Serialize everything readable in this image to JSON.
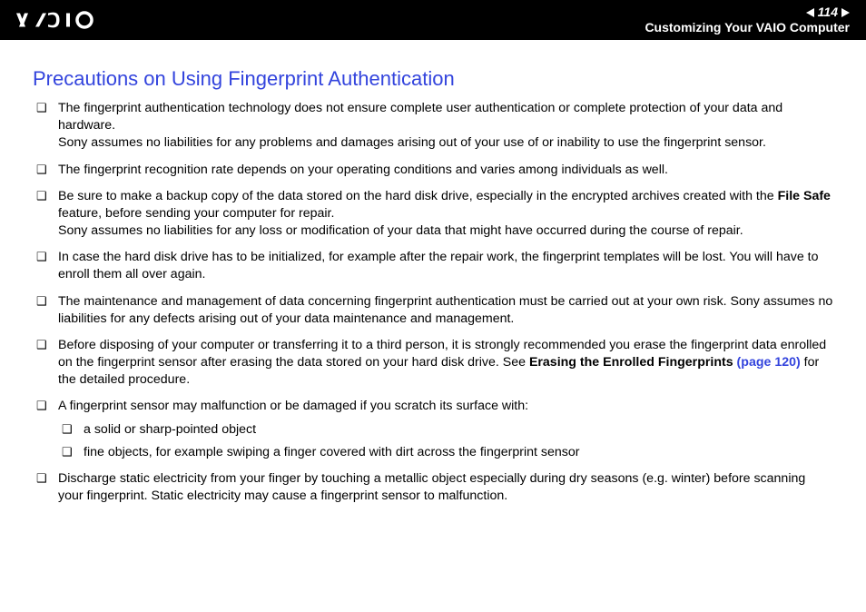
{
  "header": {
    "page_number": "114",
    "section": "Customizing Your VAIO Computer"
  },
  "title": "Precautions on Using Fingerprint Authentication",
  "bullets": [
    {
      "text_a": "The fingerprint authentication technology does not ensure complete user authentication or complete protection of your data and hardware.",
      "text_b": "Sony assumes no liabilities for any problems and damages arising out of your use of or inability to use the fingerprint sensor."
    },
    {
      "text_a": "The fingerprint recognition rate depends on your operating conditions and varies among individuals as well."
    },
    {
      "pre": "Be sure to make a backup copy of the data stored on the hard disk drive, especially in the encrypted archives created with the ",
      "bold": "File Safe",
      "post": " feature, before sending your computer for repair.",
      "text_b": "Sony assumes no liabilities for any loss or modification of your data that might have occurred during the course of repair."
    },
    {
      "text_a": "In case the hard disk drive has to be initialized, for example after the repair work, the fingerprint templates will be lost. You will have to enroll them all over again."
    },
    {
      "text_a": "The maintenance and management of data concerning fingerprint authentication must be carried out at your own risk. Sony assumes no liabilities for any defects arising out of your data maintenance and management."
    },
    {
      "pre": "Before disposing of your computer or transferring it to a third person, it is strongly recommended you erase the fingerprint data enrolled on the fingerprint sensor after erasing the data stored on your hard disk drive. See ",
      "bold": "Erasing the Enrolled Fingerprints ",
      "link": "(page 120)",
      "post": " for the detailed procedure."
    },
    {
      "text_a": "A fingerprint sensor may malfunction or be damaged if you scratch its surface with:",
      "sub": [
        "a solid or sharp-pointed object",
        "fine objects, for example swiping a finger covered with dirt across the fingerprint sensor"
      ]
    },
    {
      "text_a": "Discharge static electricity from your finger by touching a metallic object especially during dry seasons (e.g. winter) before scanning your fingerprint. Static electricity may cause a fingerprint sensor to malfunction."
    }
  ]
}
